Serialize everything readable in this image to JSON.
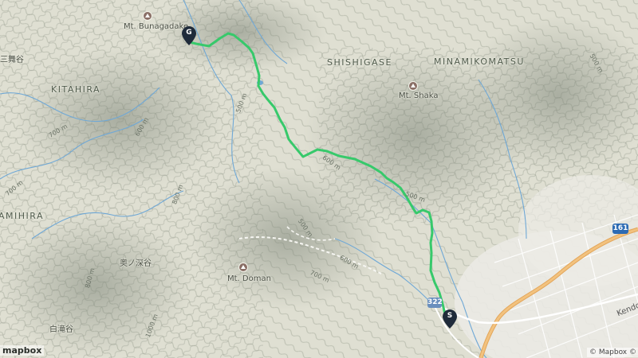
{
  "places": {
    "kitahira": "KITAHIRA",
    "shishigase": "SHISHIGASE",
    "minamikomatsu": "MINAMIKOMATSU",
    "mihira": "AMIHIRA"
  },
  "peaks": {
    "bunagadake": "Mt. Bunagadake",
    "shaka": "Mt. Shaka",
    "doman": "Mt. Doman"
  },
  "local_labels": {
    "okunofukatani": "奥ノ深谷",
    "shirataki": "白滝谷",
    "jougouma": "三舞谷"
  },
  "contours": [
    "500 m",
    "600 m",
    "700 m",
    "800 m",
    "500 m",
    "600 m",
    "700 m",
    "500 m",
    "600 m",
    "700 m",
    "800 m",
    "1000 m",
    "500 m"
  ],
  "route": {
    "start_label": "S",
    "finish_label": "G",
    "color": "#37c96b"
  },
  "roads": {
    "shield_161": "161",
    "shield_322": "322",
    "kendo_name": "Kendo"
  },
  "footer": {
    "logo_text": "mapbox",
    "attribution": "© Mapbox © OpenS"
  },
  "colors": {
    "land": "#dfdfd2",
    "terrain_shadow": "#8d9489",
    "water": "#6fa8d6",
    "highway": "#efb873",
    "marker": "#1f2b3a"
  }
}
